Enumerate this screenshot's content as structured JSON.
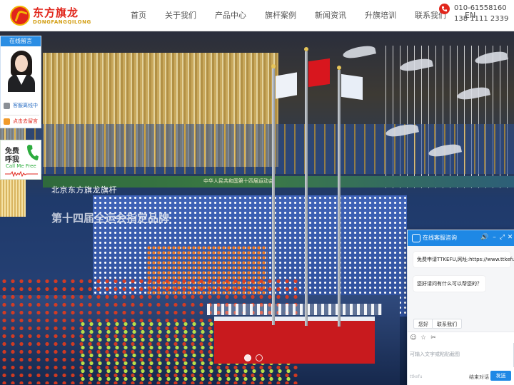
{
  "brand": {
    "name_cn": "东方旗龙",
    "name_en": "DONGFANGQILONG"
  },
  "nav": {
    "items": [
      {
        "label": "首页"
      },
      {
        "label": "关于我们"
      },
      {
        "label": "产品中心"
      },
      {
        "label": "旗杆案例"
      },
      {
        "label": "新闻资讯"
      },
      {
        "label": "升旗培训"
      },
      {
        "label": "联系我们"
      },
      {
        "label": "EN"
      }
    ]
  },
  "contact": {
    "phone_1": "010-61558160",
    "phone_2": "138 1111 2339"
  },
  "hero": {
    "line_1": "北京东方旗龙旗杆",
    "line_2": "第十四届全运会指定品牌",
    "ribbon_text": "中华人民共和国第十四届运动会",
    "slide_count": 2,
    "active_slide": 1
  },
  "online_panel": {
    "title": "在线留言",
    "status": "客服离线中",
    "leave_message": "点击去留言"
  },
  "callme": {
    "line_1": "免费",
    "line_2": "呼我",
    "english": "Call Me Free"
  },
  "chat": {
    "title": "在线客服咨询",
    "message_1": "免费申请TTKEFU,网址:https://www.ttkefu.com",
    "message_2": "您好请问有什么可以帮您的？",
    "quick_replies": [
      {
        "label": "您好"
      },
      {
        "label": "联系我们"
      }
    ],
    "input_placeholder": "可输入文字或粘贴截图",
    "footer_brand": "ttkefu",
    "end_chat": "结束对话",
    "send": "发送",
    "accent_color": "#1e88e5"
  }
}
